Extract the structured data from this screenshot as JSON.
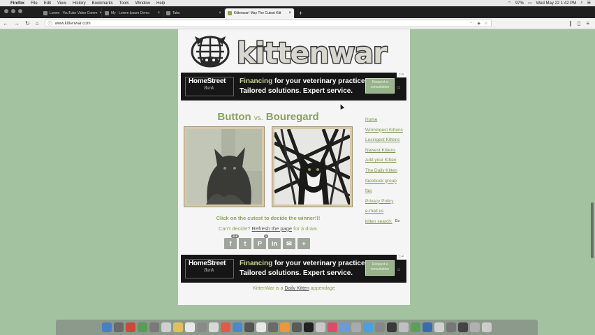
{
  "menubar": {
    "app": "Firefox",
    "items": [
      "File",
      "Edit",
      "View",
      "History",
      "Bookmarks",
      "Tools",
      "Window",
      "Help"
    ],
    "battery": "97%",
    "clock": "Wed May 22  1:42 PM"
  },
  "tabs": [
    {
      "label": "Lorem · YouTube Video Comm"
    },
    {
      "label": "My · Lorem Ipsum Demo"
    },
    {
      "label": "Tabs"
    },
    {
      "label": "Kittenwar! May The Cutest Kitt",
      "active": true
    }
  ],
  "browser": {
    "url": "www.kittenwar.com"
  },
  "site": {
    "logo_text": "kittenwar",
    "ad": {
      "brand_main": "HomeStreet",
      "brand_sub": "Bank",
      "headline_a": "Financing",
      "headline_b": " for your veterinary practice.",
      "tagline": "Tailored solutions. Expert service.",
      "cta": "Request a consultation"
    },
    "matchup": {
      "left": "Button",
      "vs": "vs.",
      "right": "Bouregard"
    },
    "pick_text": "Click on the cutest to decide the winner!!!",
    "draw_prefix": "Can't decide? ",
    "draw_link": "Refresh the page",
    "draw_suffix": " for a draw.",
    "social": [
      {
        "icon": "facebook-icon",
        "glyph": "f",
        "count": "316"
      },
      {
        "icon": "twitter-icon",
        "glyph": "t",
        "count": ""
      },
      {
        "icon": "pinterest-icon",
        "glyph": "P",
        "count": "0"
      },
      {
        "icon": "linkedin-icon",
        "glyph": "in",
        "count": ""
      },
      {
        "icon": "email-icon",
        "glyph": "✉",
        "count": ""
      },
      {
        "icon": "more-icon",
        "glyph": "+",
        "count": ""
      }
    ],
    "nav": [
      "Home",
      "Winningest Kittens",
      "Losingest Kittens",
      "Newest Kittens",
      "Add your Kitten",
      "The Daily Kitten",
      "facebook group",
      "faq",
      "Privacy Policy",
      "e-mail us"
    ],
    "search_label": "kitten search:",
    "search_go": "Go",
    "footer_a": "KittenWar is a ",
    "footer_link": "Daily Kitten",
    "footer_b": " appendage"
  },
  "colors": {
    "desktop": "#a3c3a0",
    "accent_green": "#8aa25b",
    "ad_bg": "#161616"
  }
}
